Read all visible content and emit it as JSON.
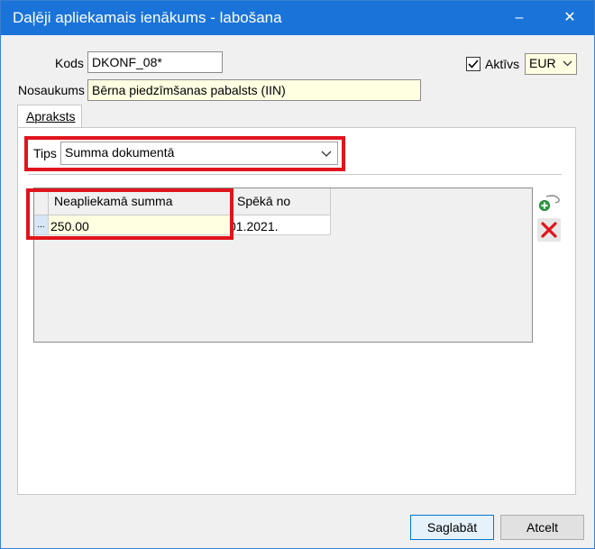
{
  "window": {
    "title": "Daļēji apliekamais ienākums - labošana",
    "minimize_glyph": "–",
    "close_glyph": "✕"
  },
  "form": {
    "kods_label": "Kods",
    "kods_value": "DKONF_08*",
    "nosaukums_label": "Nosaukums",
    "nosaukums_value": "Bērna piedzīmšanas pabalsts (IIN)",
    "aktivs_label": "Aktīvs",
    "aktivs_checked": true,
    "currency_value": "EUR"
  },
  "tabs": [
    {
      "label": "Apraksts"
    }
  ],
  "tips": {
    "label": "Tips",
    "value": "Summa dokumentā"
  },
  "grid": {
    "columns": [
      "Neapliekamā summa",
      "Spēkā no"
    ],
    "rows": [
      {
        "indicator": "...",
        "amount": "250.00",
        "date": "01.2021."
      }
    ]
  },
  "buttons": {
    "save": "Saglabāt",
    "cancel": "Atcelt"
  },
  "colors": {
    "title_bar": "#1a73d9",
    "highlight": "#e0141c",
    "field_yellow": "#ffffe1"
  }
}
